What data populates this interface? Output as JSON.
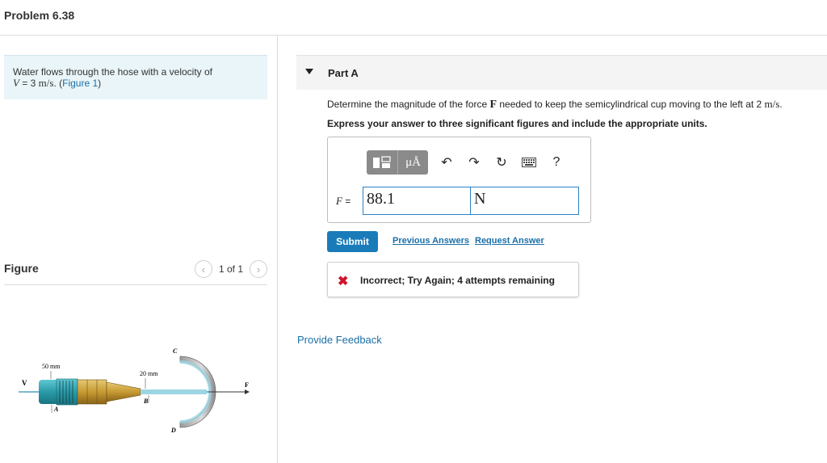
{
  "header": {
    "title": "Problem 6.38"
  },
  "intro": {
    "line1": "Water flows through the hose with a velocity of",
    "var_v": "V",
    "eq": " = 3 ",
    "unit": "m/s",
    "dot": ". (",
    "figure_link": "Figure 1",
    "close": ")"
  },
  "figure_panel": {
    "label": "Figure",
    "prev_icon": "chevron-left-icon",
    "next_icon": "chevron-right-icon",
    "pager_text": "1 of 1"
  },
  "figure_labels": {
    "d1": "50 mm",
    "d2": "20 mm",
    "v": "V",
    "a": "A",
    "b": "B",
    "c": "C",
    "d": "D",
    "f": "F"
  },
  "part": {
    "caret_icon": "caret-down-icon",
    "label": "Part A",
    "question_pre": "Determine the magnitude of the force ",
    "question_var": "F",
    "question_mid": " needed to keep the semicylindrical cup moving to the left at 2 ",
    "question_unit": "m/s",
    "question_end": ".",
    "instruction": "Express your answer to three significant figures and include the appropriate units."
  },
  "toolbar": {
    "templates_icon": "templates-icon",
    "units_label": "μÅ",
    "undo_icon": "undo-icon",
    "redo_icon": "redo-icon",
    "reset_icon": "reset-icon",
    "keyboard_icon": "keyboard-icon",
    "help_label": "?"
  },
  "answer": {
    "label": "F",
    "equals": " =",
    "value": "88.1",
    "unit": "N"
  },
  "actions": {
    "submit": "Submit",
    "previous_answers": "Previous Answers",
    "request_answer": "Request Answer"
  },
  "feedback": {
    "icon": "x-icon",
    "symbol": "✖",
    "message": "Incorrect; Try Again; 4 attempts remaining"
  },
  "provide_feedback": "Provide Feedback",
  "colors": {
    "accent": "#1a7bb9",
    "link": "#1a6fa8",
    "error": "#d0142c",
    "intro_bg": "#e9f5f8"
  }
}
